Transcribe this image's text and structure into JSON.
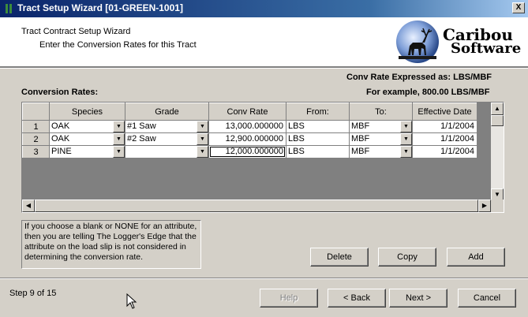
{
  "window": {
    "title": "Tract Setup Wizard [01-GREEN-1001]",
    "close_glyph": "X"
  },
  "header": {
    "title": "Tract Contract Setup Wizard",
    "subtitle": "Enter the Conversion Rates for this Tract",
    "logo": {
      "line1": "Caribou",
      "line2": "Software"
    }
  },
  "section": {
    "label": "Conversion Rates:",
    "expressed_as": "Conv Rate Expressed as: LBS/MBF",
    "example": "For example, 800.00 LBS/MBF"
  },
  "grid": {
    "columns": [
      "Species",
      "Grade",
      "Conv Rate",
      "From:",
      "To:",
      "Effective Date"
    ],
    "rows": [
      {
        "num": "1",
        "species": "OAK",
        "grade": "#1 Saw",
        "rate": "13,000.000000",
        "from": "LBS",
        "to": "MBF",
        "date": "1/1/2004"
      },
      {
        "num": "2",
        "species": "OAK",
        "grade": "#2 Saw",
        "rate": "12,900.000000",
        "from": "LBS",
        "to": "MBF",
        "date": "1/1/2004"
      },
      {
        "num": "3",
        "species": "PINE",
        "grade": "",
        "rate": "12,000.000000",
        "from": "LBS",
        "to": "MBF",
        "date": "1/1/2004"
      }
    ]
  },
  "note": "If you choose a blank or NONE for an attribute, then you are telling The Logger's Edge that the attribute on the load slip is not considered in determining the conversion rate.",
  "buttons": {
    "delete": "Delete",
    "copy": "Copy",
    "add": "Add"
  },
  "footer": {
    "step": "Step 9 of 15",
    "help": "Help",
    "back": "< Back",
    "next": "Next >",
    "cancel": "Cancel"
  },
  "colors": {
    "titlebar_start": "#0a246a",
    "titlebar_end": "#a6caf0",
    "face": "#d4d0c8"
  }
}
